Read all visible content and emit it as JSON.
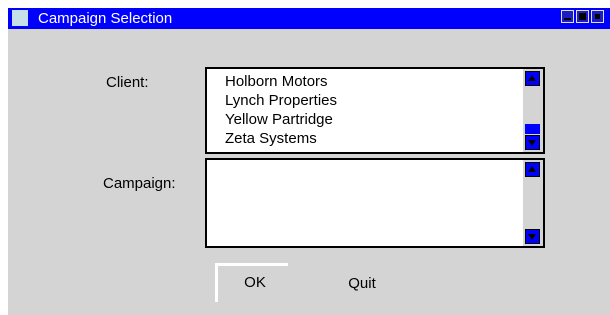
{
  "window": {
    "title": "Campaign Selection",
    "colors": {
      "titlebar": "#0000ff",
      "background": "#d4d4d4",
      "listbox": "#ffffff",
      "scrollbar_accent": "#0000ff"
    },
    "icons": [
      "app-icon",
      "minimize-icon",
      "maximize-icon",
      "close-icon"
    ]
  },
  "form": {
    "client_label": "Client:",
    "campaign_label": "Campaign:",
    "client_items": [
      "Holborn Motors",
      "Lynch Properties",
      "Yellow Partridge",
      "Zeta Systems"
    ],
    "campaign_items": []
  },
  "buttons": {
    "ok": "OK",
    "quit": "Quit"
  }
}
